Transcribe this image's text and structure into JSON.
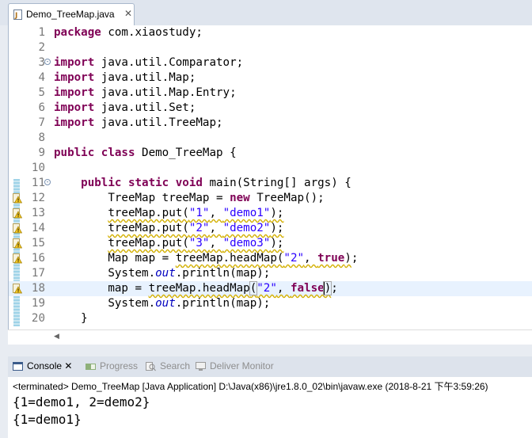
{
  "editor": {
    "tab_title": "Demo_TreeMap.java",
    "tab_close": "✕",
    "lines": [
      {
        "n": "1",
        "tokens": [
          {
            "t": "package",
            "c": "kw"
          },
          {
            "t": " com.xiaostudy;"
          }
        ]
      },
      {
        "n": "2",
        "tokens": []
      },
      {
        "n": "3",
        "fold": true,
        "tokens": [
          {
            "t": "import",
            "c": "kw"
          },
          {
            "t": " java.util.Comparator;"
          }
        ]
      },
      {
        "n": "4",
        "tokens": [
          {
            "t": "import",
            "c": "kw"
          },
          {
            "t": " java.util.Map;"
          }
        ]
      },
      {
        "n": "5",
        "tokens": [
          {
            "t": "import",
            "c": "kw"
          },
          {
            "t": " java.util.Map.Entry;"
          }
        ]
      },
      {
        "n": "6",
        "tokens": [
          {
            "t": "import",
            "c": "kw"
          },
          {
            "t": " java.util.Set;"
          }
        ]
      },
      {
        "n": "7",
        "tokens": [
          {
            "t": "import",
            "c": "kw"
          },
          {
            "t": " java.util.TreeMap;"
          }
        ]
      },
      {
        "n": "8",
        "tokens": []
      },
      {
        "n": "9",
        "tokens": [
          {
            "t": "public",
            "c": "kw"
          },
          {
            "t": " "
          },
          {
            "t": "class",
            "c": "kw"
          },
          {
            "t": " Demo_TreeMap {"
          }
        ]
      },
      {
        "n": "10",
        "tokens": []
      },
      {
        "n": "11",
        "fold": true,
        "tokens": [
          {
            "t": "    "
          },
          {
            "t": "public",
            "c": "kw"
          },
          {
            "t": " "
          },
          {
            "t": "static",
            "c": "kw"
          },
          {
            "t": " "
          },
          {
            "t": "void",
            "c": "kw"
          },
          {
            "t": " main(String[] args) {"
          }
        ]
      },
      {
        "n": "12",
        "warn": true,
        "tokens": [
          {
            "t": "        TreeMap treeMap = "
          },
          {
            "t": "new",
            "c": "kw"
          },
          {
            "t": " TreeMap();"
          }
        ]
      },
      {
        "n": "13",
        "warn": true,
        "tokens": [
          {
            "t": "        "
          },
          {
            "t": "treeMap.put(",
            "c": "warn"
          },
          {
            "t": "\"1\"",
            "c": "str warn"
          },
          {
            "t": ", ",
            "c": "warn"
          },
          {
            "t": "\"demo1\"",
            "c": "str warn"
          },
          {
            "t": ");",
            "c": "warn"
          }
        ]
      },
      {
        "n": "14",
        "warn": true,
        "tokens": [
          {
            "t": "        "
          },
          {
            "t": "treeMap.put(",
            "c": "warn"
          },
          {
            "t": "\"2\"",
            "c": "str warn"
          },
          {
            "t": ", ",
            "c": "warn"
          },
          {
            "t": "\"demo2\"",
            "c": "str warn"
          },
          {
            "t": ");",
            "c": "warn"
          }
        ]
      },
      {
        "n": "15",
        "warn": true,
        "tokens": [
          {
            "t": "        "
          },
          {
            "t": "treeMap.put(",
            "c": "warn"
          },
          {
            "t": "\"3\"",
            "c": "str warn"
          },
          {
            "t": ", ",
            "c": "warn"
          },
          {
            "t": "\"demo3\"",
            "c": "str warn"
          },
          {
            "t": ");",
            "c": "warn"
          }
        ]
      },
      {
        "n": "16",
        "warn": true,
        "tokens": [
          {
            "t": "        Map map = "
          },
          {
            "t": "treeMap.headMap(",
            "c": "warn"
          },
          {
            "t": "\"2\"",
            "c": "str warn"
          },
          {
            "t": ", ",
            "c": "warn"
          },
          {
            "t": "true",
            "c": "kw warn"
          },
          {
            "t": ")",
            "c": "warn"
          },
          {
            "t": ";"
          }
        ]
      },
      {
        "n": "17",
        "tokens": [
          {
            "t": "        System."
          },
          {
            "t": "out",
            "c": "fld"
          },
          {
            "t": ".println(map);"
          }
        ]
      },
      {
        "n": "18",
        "warn": true,
        "current": true,
        "tokens": [
          {
            "t": "        map = "
          },
          {
            "t": "treeMap.headMap",
            "c": "warn"
          },
          {
            "t": "(",
            "c": "warn bracket-box"
          },
          {
            "t": "\"2\"",
            "c": "str warn"
          },
          {
            "t": ", ",
            "c": "warn"
          },
          {
            "t": "false",
            "c": "kw warn"
          },
          {
            "t": ")",
            "c": "warn caret bracket-box"
          },
          {
            "t": ";"
          }
        ]
      },
      {
        "n": "19",
        "tokens": [
          {
            "t": "        System."
          },
          {
            "t": "out",
            "c": "fld"
          },
          {
            "t": ".println(map);"
          }
        ]
      },
      {
        "n": "20",
        "tokens": [
          {
            "t": "    }"
          }
        ]
      }
    ]
  },
  "views": {
    "tabs": [
      {
        "label": "Console ✕",
        "icon": "console-icon",
        "active": true
      },
      {
        "label": "Progress",
        "icon": "progress-icon",
        "active": false
      },
      {
        "label": "Search",
        "icon": "search-icon",
        "active": false
      },
      {
        "label": "Deliver Monitor",
        "icon": "monitor-icon",
        "active": false
      }
    ]
  },
  "console": {
    "header": "<terminated> Demo_TreeMap [Java Application] D:\\Java(x86)\\jre1.8.0_02\\bin\\javaw.exe (2018-8-21 下午3:59:26)",
    "output": [
      "{1=demo1, 2=demo2}",
      "{1=demo1}"
    ]
  },
  "colors": {
    "keyword": "#7f0055",
    "string": "#2a00ff",
    "static_field": "#0000c0",
    "current_line": "#e8f2fe",
    "warning_underline": "#d4b106"
  }
}
